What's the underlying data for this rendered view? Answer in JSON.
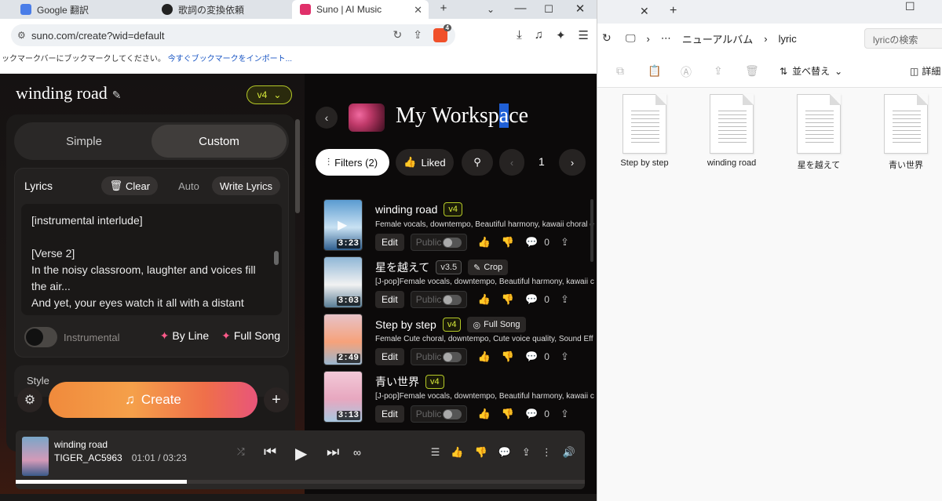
{
  "browser": {
    "tabs": [
      {
        "label": "Google 翻訳"
      },
      {
        "label": "歌詞の変換依頼"
      },
      {
        "label": "Suno | AI Music"
      }
    ],
    "url": "suno.com/create?wid=default",
    "brave_count": "4",
    "bookmark_prompt": "ックマークバーにブックマークしてください。",
    "bookmark_import": "今すぐブックマークをインポート..."
  },
  "suno": {
    "song_title": "winding road",
    "model_label": "v4",
    "modes": {
      "simple": "Simple",
      "custom": "Custom"
    },
    "lyrics": {
      "label": "Lyrics",
      "clear": "Clear",
      "auto": "Auto",
      "write": "Write Lyrics",
      "lines": [
        "[instrumental interlude]",
        "",
        "[Verse 2]",
        "In the noisy classroom, laughter and voices fill the air...",
        "And yet, your eyes watch it all with a distant chill."
      ],
      "instrumental": "Instrumental",
      "by_line": "By Line",
      "full_song": "Full Song"
    },
    "style_partial": "Style",
    "create_label": "Create",
    "workspace": {
      "title_before": "My Worksp",
      "title_selected": "a",
      "title_after": "ce",
      "filters": "Filters (2)",
      "liked": "Liked",
      "page": "1"
    },
    "songs": [
      {
        "title": "winding road",
        "version": "v4",
        "extra": "",
        "desc": "Female vocals, downtempo, Beautiful harmony, kawaii choral e",
        "duration": "3:23",
        "edit": "Edit",
        "public": "Public",
        "comments": "0",
        "colors": [
          "#5a9bd0",
          "#c9e2f3",
          "#2f5f8f"
        ]
      },
      {
        "title": "星を越えて",
        "version": "v3.5",
        "extra": "Crop",
        "desc": "[J-pop]Female vocals, downtempo, Beautiful harmony, kawaii c",
        "duration": "3:03",
        "edit": "Edit",
        "public": "Public",
        "comments": "0",
        "colors": [
          "#8fb6d6",
          "#f2f2f2",
          "#5a7e96"
        ]
      },
      {
        "title": "Step by step",
        "version": "v4",
        "extra": "Full Song",
        "desc": "Female Cute choral, downtempo, Cute voice quality, Sound Eff",
        "duration": "2:49",
        "edit": "Edit",
        "public": "Public",
        "comments": "0",
        "colors": [
          "#e7c2c8",
          "#f6a27a",
          "#9ab6cf"
        ]
      },
      {
        "title": "青い世界",
        "version": "v4",
        "extra": "",
        "desc": "[J-pop]Female vocals, downtempo, Beautiful harmony, kawaii c",
        "duration": "3:13",
        "edit": "Edit",
        "public": "Public",
        "comments": "0",
        "colors": [
          "#f3c9d8",
          "#e7a7bf",
          "#a8c7e0"
        ]
      }
    ],
    "player": {
      "title": "winding road",
      "artist": "TIGER_AC5963",
      "time": "01:01 / 03:23",
      "progress": 0.3
    }
  },
  "explorer": {
    "breadcrumb": [
      "ニューアルバム",
      "lyric"
    ],
    "search_placeholder": "lyricの検索",
    "sort_label": "並べ替え",
    "details_label": "詳細",
    "files": [
      "Step by step",
      "winding road",
      "星を越えて",
      "青い世界"
    ]
  }
}
